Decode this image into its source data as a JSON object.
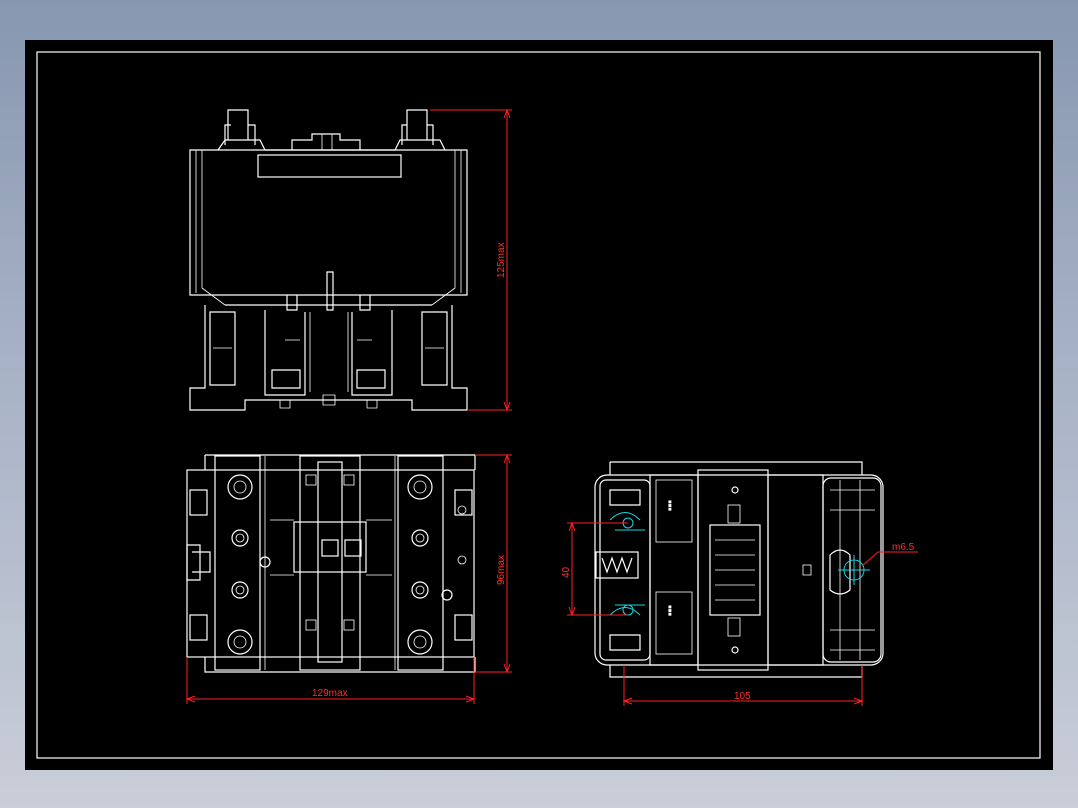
{
  "drawing": {
    "dimensions": {
      "height_top": "125max",
      "height_mid": "96max",
      "width": "129max",
      "hole_spacing": "40",
      "depth": "105",
      "hole_dia": "m6.5"
    },
    "colors": {
      "background": "#000000",
      "outline": "#ffffff",
      "dimension": "#ff2020",
      "center_line": "#19d6e6"
    }
  }
}
